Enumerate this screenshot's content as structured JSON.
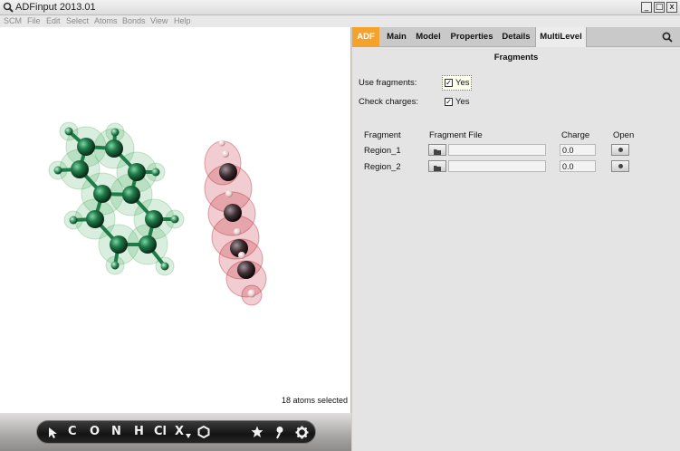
{
  "window": {
    "title": "ADFinput 2013.01",
    "min": "_",
    "max": "□",
    "close": "x"
  },
  "menu": [
    "SCM",
    "File",
    "Edit",
    "Select",
    "Atoms",
    "Bonds",
    "View",
    "Help"
  ],
  "tabs": [
    "ADF",
    "Main",
    "Model",
    "Properties",
    "Details",
    "MultiLevel"
  ],
  "active_tab": "MultiLevel",
  "panel": {
    "title": "Fragments",
    "use_fragments_label": "Use fragments:",
    "use_fragments_value": "Yes",
    "check_charges_label": "Check charges:",
    "check_charges_value": "Yes",
    "checkmark": "✓",
    "table": {
      "headers": [
        "Fragment",
        "Fragment File",
        "Charge",
        "Open"
      ],
      "rows": [
        {
          "fragment": "Region_1",
          "file": "",
          "charge": "0.0"
        },
        {
          "fragment": "Region_2",
          "file": "",
          "charge": "0.0"
        }
      ]
    }
  },
  "viewport": {
    "status": "18 atoms selected",
    "toolbar": [
      "C",
      "O",
      "N",
      "H",
      "Cl",
      "X"
    ],
    "toolbar_icons": [
      "select-arrow-icon",
      "ring-icon",
      "star-icon",
      "pin-icon",
      "gear-icon"
    ]
  },
  "colors": {
    "adf_tab": "#f3a22b",
    "green_atoms": "#1f7a48",
    "red_fragment": "#b71b1b"
  }
}
